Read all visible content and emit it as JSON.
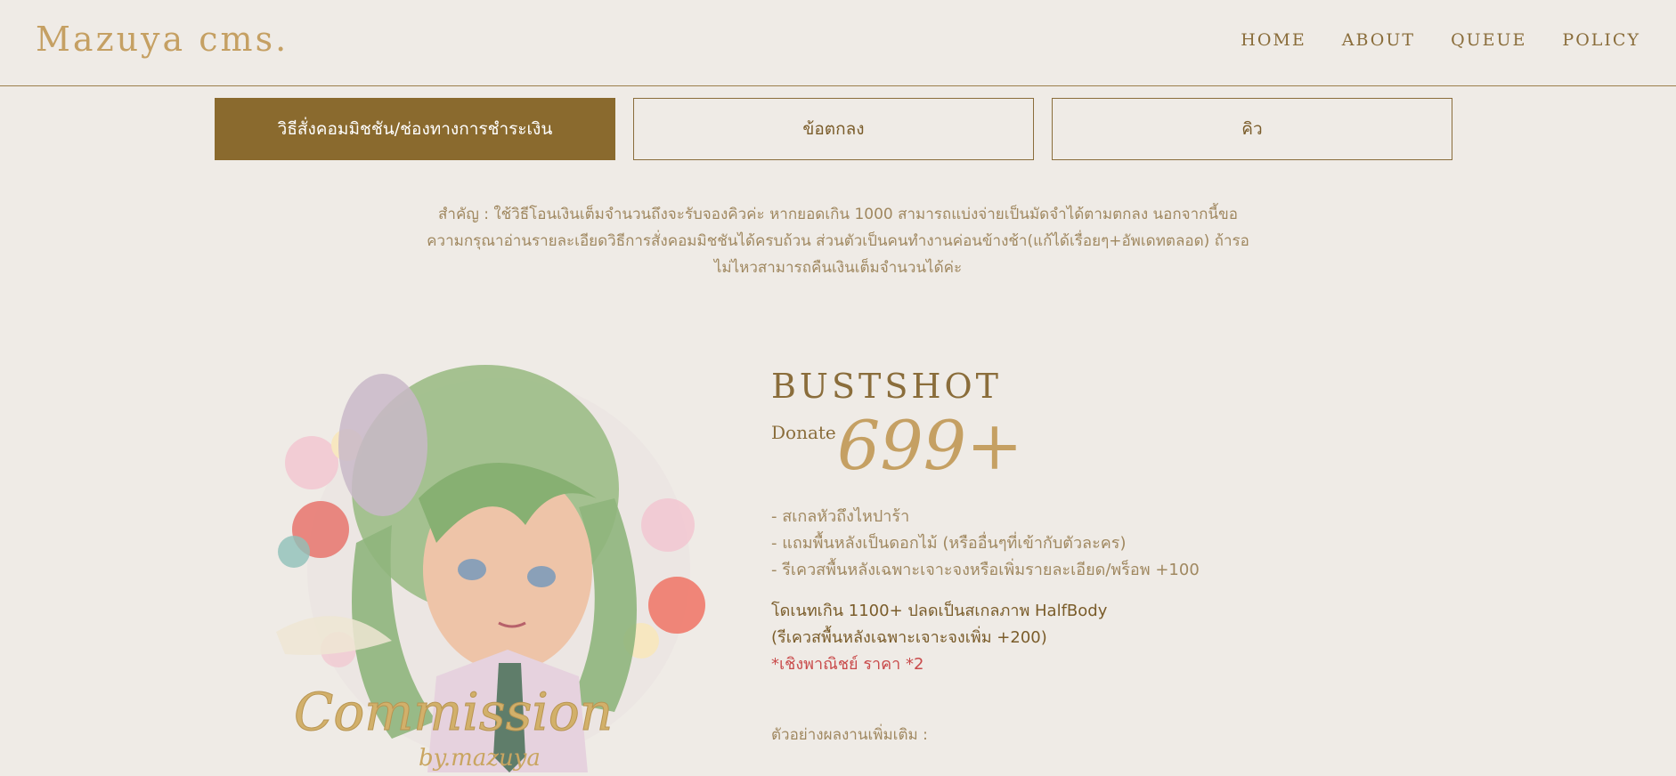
{
  "header": {
    "logo": "Mazuya cms.",
    "nav": [
      "HOME",
      "ABOUT",
      "QUEUE",
      "POLICY"
    ]
  },
  "tabs": [
    {
      "label": "วิธีสั่งคอมมิชชัน/ช่องทางการชำระเงิน",
      "active": true
    },
    {
      "label": "ข้อตกลง",
      "active": false
    },
    {
      "label": "คิว",
      "active": false
    }
  ],
  "notice": [
    "สำคัญ : ใช้วิธีโอนเงินเต็มจำนวนถึงจะรับจองคิวค่ะ หากยอดเกิน 1000 สามารถแบ่งจ่ายเป็นมัดจำได้ตามตกลง นอกจากนี้ขอ",
    "ความกรุณาอ่านรายละเอียดวิธีการสั่งคอมมิชชันได้ครบถ้วน ส่วนตัวเป็นคนทำงานค่อนข้างช้า(แก้ได้เรื่อยๆ+อัพเดทตลอด) ถ้ารอ",
    "ไม่ไหวสามารถคืนเงินเต็มจำนวนได้ค่ะ"
  ],
  "product": {
    "title": "BUSTSHOT",
    "donate_label": "Donate",
    "price": "699+",
    "features": [
      "- สเกลหัวถึงไหปาร้า",
      "- แถมพื้นหลังเป็นดอกไม้ (หรืออื่นๆที่เข้ากับตัวละคร)",
      "- รีเควสพื้นหลังเฉพาะเจาะจงหรือเพิ่มรายละเอียด/พร็อพ +100"
    ],
    "upgrade_line1": "โดเนทเกิน 1100+ ปลดเป็นสเกลภาพ HalfBody",
    "upgrade_line2": "(รีเควสพื้นหลังเฉพาะเจาะจงเพิ่ม +200)",
    "commercial": "*เชิงพาณิชย์ ราคา *2",
    "more_examples": "ตัวอย่างผลงานเพิ่มเติม :"
  },
  "artwork": {
    "signature": "Commission",
    "sub_signature": "by.mazuya"
  },
  "colors": {
    "background": "#efebe6",
    "accent": "#8a6a2e",
    "gold": "#c5a063",
    "commercial": "#c94b4b"
  }
}
